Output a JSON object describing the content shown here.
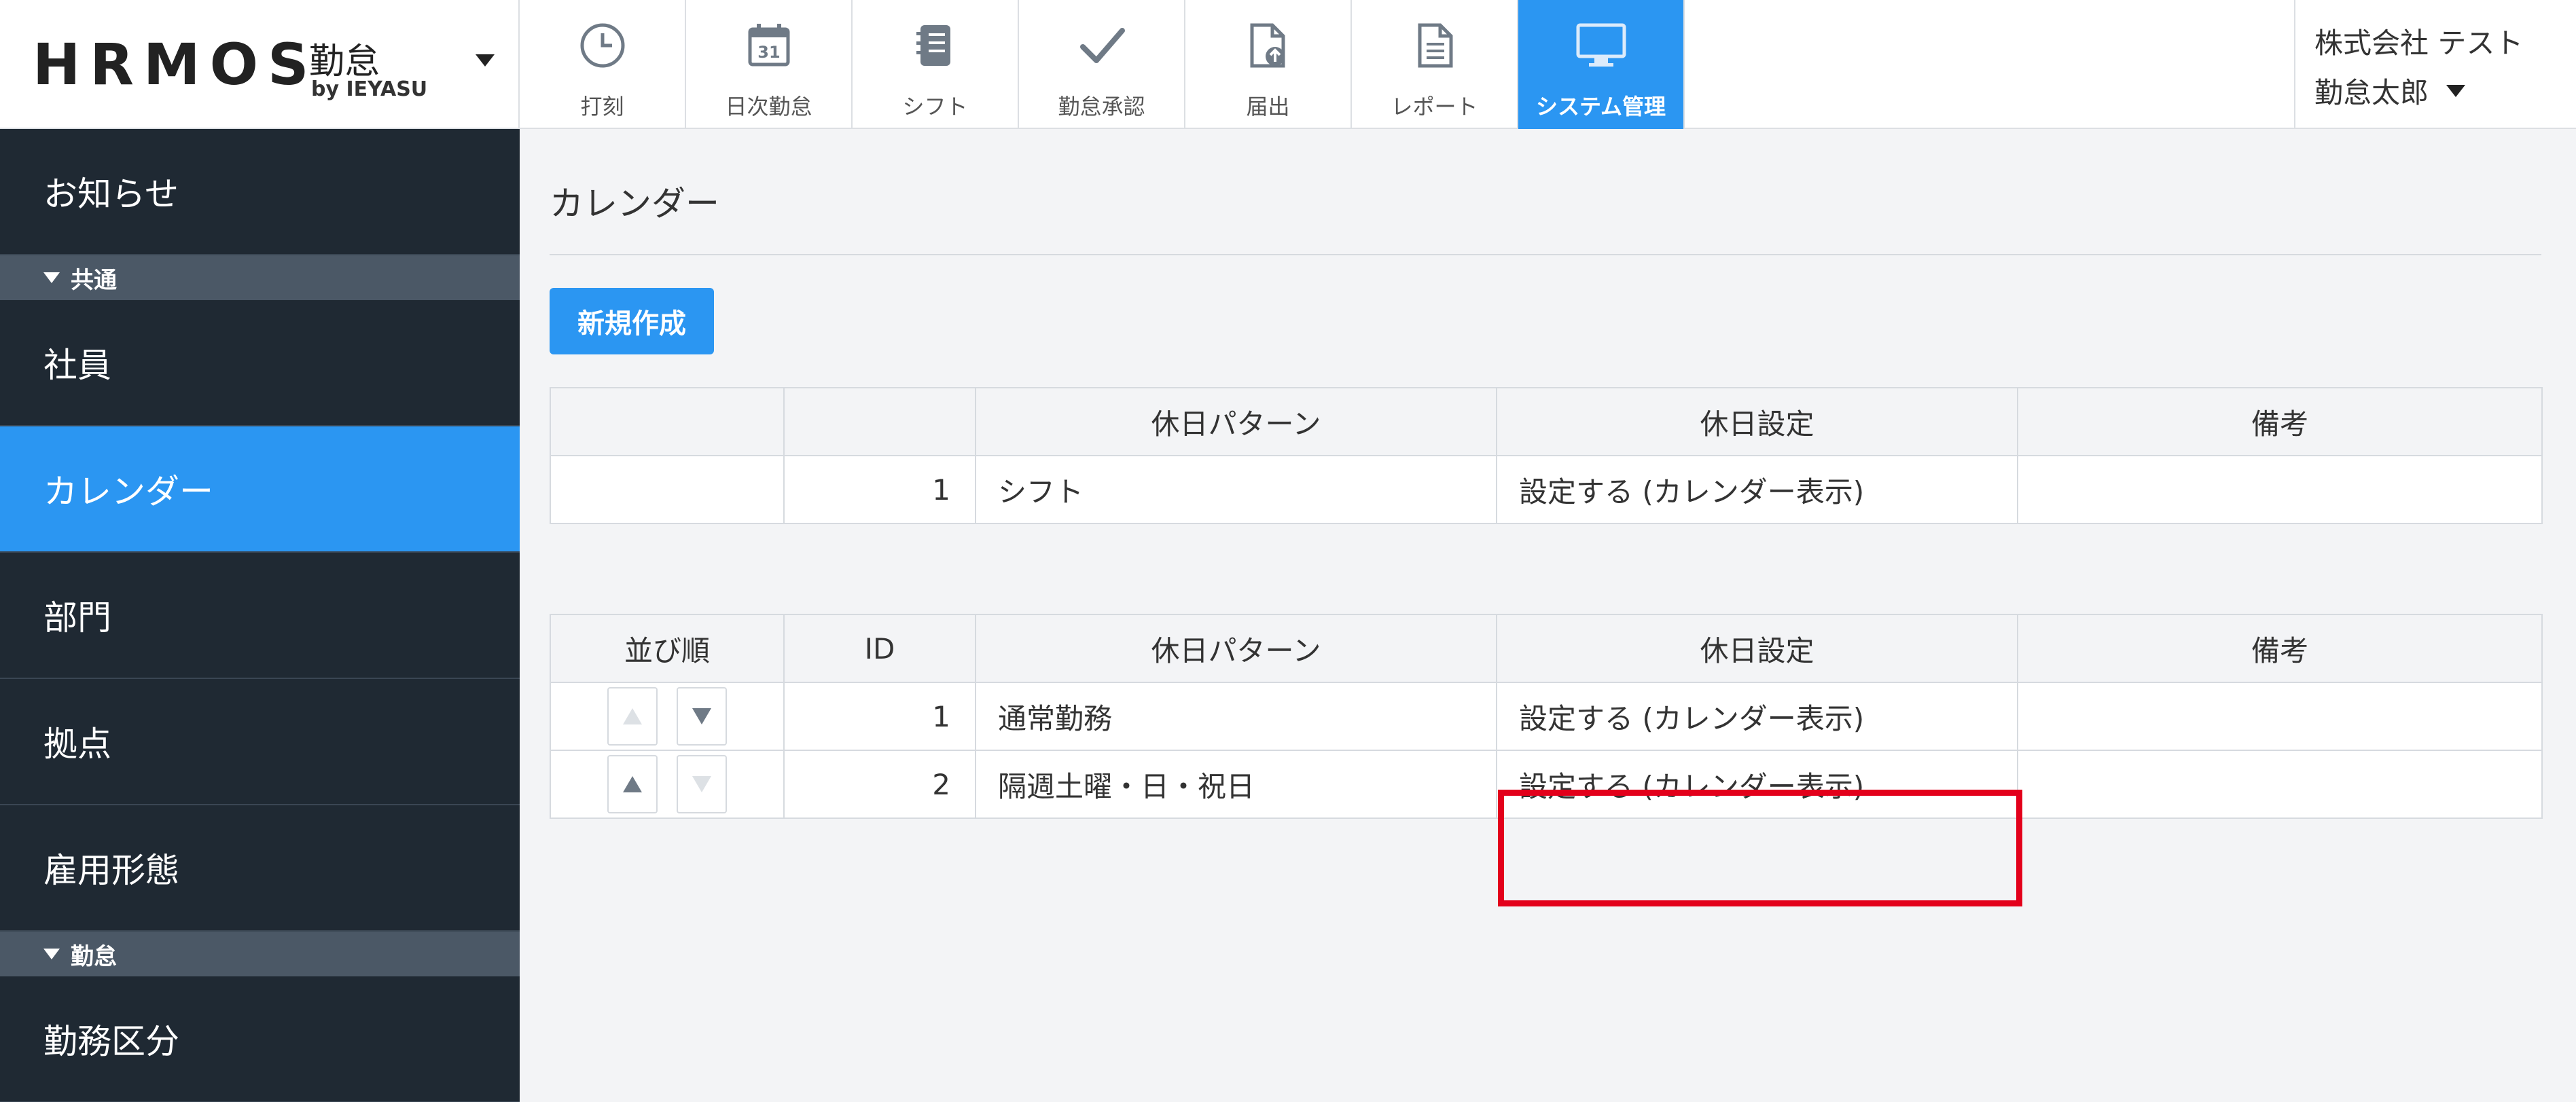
{
  "header": {
    "logo_main": "HRMOS",
    "logo_kintai": "勤怠",
    "logo_by": "by IEYASU",
    "nav": [
      {
        "label": "打刻",
        "icon": "clock-icon"
      },
      {
        "label": "日次勤怠",
        "icon": "calendar-icon"
      },
      {
        "label": "シフト",
        "icon": "notebook-icon"
      },
      {
        "label": "勤怠承認",
        "icon": "check-icon"
      },
      {
        "label": "届出",
        "icon": "document-upload-icon"
      },
      {
        "label": "レポート",
        "icon": "document-icon"
      },
      {
        "label": "システム管理",
        "icon": "monitor-icon",
        "active": true
      }
    ],
    "user_company": "株式会社 テスト",
    "user_name": "勤怠太郎"
  },
  "sidebar": {
    "top_item": "お知らせ",
    "group_common": "共通",
    "items_common": [
      "社員",
      "カレンダー",
      "部門",
      "拠点",
      "雇用形態"
    ],
    "active_item": "カレンダー",
    "group_kintai": "勤怠",
    "items_kintai": [
      "勤務区分"
    ]
  },
  "main": {
    "page_title": "カレンダー",
    "new_button": "新規作成",
    "table1": {
      "headers": [
        "",
        "",
        "休日パターン",
        "休日設定",
        "備考"
      ],
      "rows": [
        {
          "id": "1",
          "pattern": "シフト",
          "setting": "設定する (カレンダー表示)",
          "note": ""
        }
      ]
    },
    "table2": {
      "headers": [
        "並び順",
        "ID",
        "休日パターン",
        "休日設定",
        "備考"
      ],
      "rows": [
        {
          "id": "1",
          "pattern": "通常勤務",
          "setting": "設定する (カレンダー表示)",
          "note": ""
        },
        {
          "id": "2",
          "pattern": "隔週土曜・日・祝日",
          "setting": "設定する (カレンダー表示)",
          "note": ""
        }
      ]
    }
  },
  "colors": {
    "accent": "#2b96f2",
    "sidebar_bg": "#1f2933",
    "link": "#2b88e8",
    "highlight": "#e3001b"
  }
}
